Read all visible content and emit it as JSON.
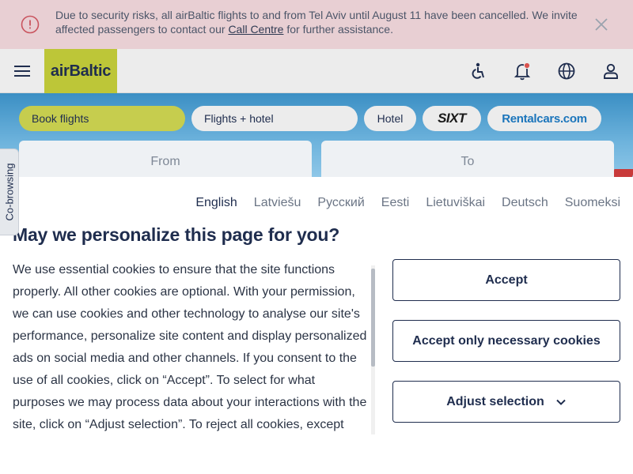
{
  "notice": {
    "text_before": "Due to security risks, all airBaltic flights to and from Tel Aviv until August 11 have been cancelled. We invite affected passengers to contact our ",
    "link": "Call Centre",
    "text_after": " for further assistance.",
    "icon": "alert-circle-icon",
    "close_icon": "close-icon"
  },
  "header": {
    "logo": "airBaltic",
    "icons": [
      "menu-icon",
      "accessibility-icon",
      "notification-bell-icon",
      "globe-icon",
      "user-account-icon"
    ]
  },
  "booking_tabs": {
    "book_flights": "Book flights",
    "flights_hotel": "Flights + hotel",
    "hotel": "Hotel",
    "sixt": "SIXT",
    "rentalcars": "Rentalcars.com"
  },
  "search": {
    "from_placeholder": "From",
    "to_placeholder": "To"
  },
  "cobrowsing": {
    "label": "Co-browsing"
  },
  "cookie_dialog": {
    "languages": [
      "English",
      "Latviešu",
      "Русский",
      "Eesti",
      "Lietuviškai",
      "Deutsch",
      "Suomeksi"
    ],
    "active_language": "English",
    "title": "May we personalize this page for you?",
    "body": "We use essential cookies to ensure that the site functions properly. All other cookies are optional. With your permission, we can use cookies and other technology to analyse our site's performance, personalize site content and display personalized ads on social media and other channels. If you consent to the use of all cookies, click on “Accept”. To select for what purposes we may process data about your interactions with the site, click on “Adjust selection”. To reject all cookies, except",
    "buttons": {
      "accept": "Accept",
      "accept_necessary": "Accept only necessary cookies",
      "adjust": "Adjust selection"
    }
  },
  "colors": {
    "brand_green": "#bdc638",
    "active_pill": "#c6cd4e",
    "navy": "#1f2d4e",
    "notice_bg": "#e8cfd3",
    "alert_red": "#c9545e"
  }
}
